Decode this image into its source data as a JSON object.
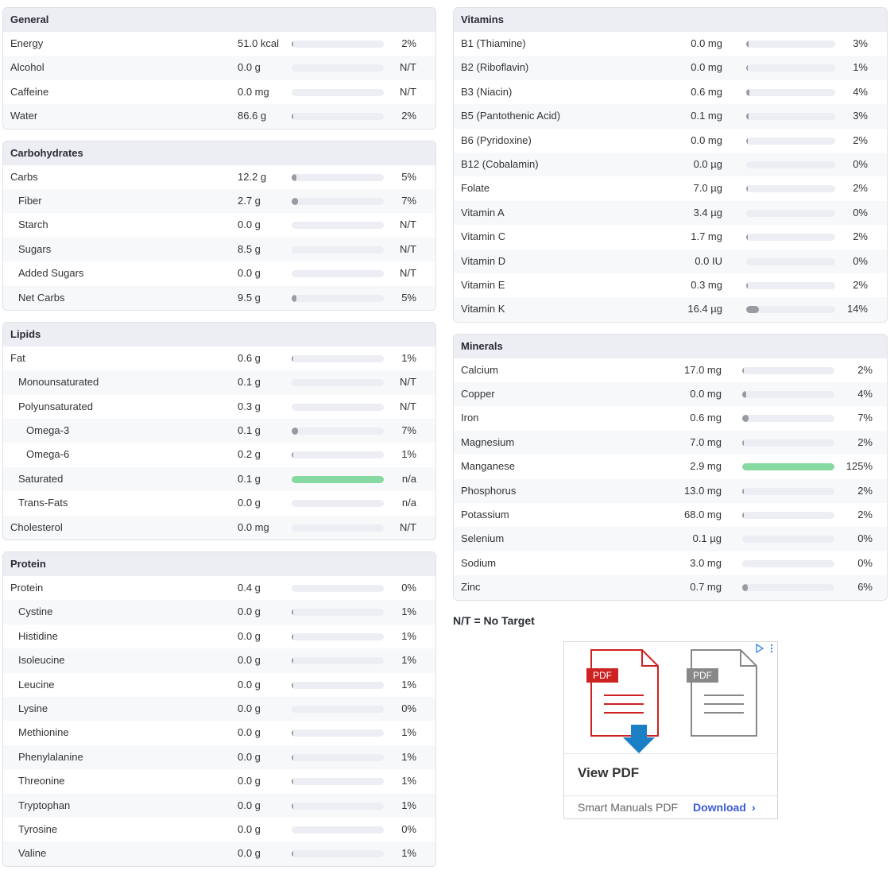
{
  "general": {
    "title": "General",
    "rows": [
      {
        "name": "Energy",
        "amount": "51.0 kcal",
        "pct": "2%",
        "level": 0.02
      },
      {
        "name": "Alcohol",
        "amount": "0.0 g",
        "pct": "N/T",
        "level": 0
      },
      {
        "name": "Caffeine",
        "amount": "0.0 mg",
        "pct": "N/T",
        "level": 0
      },
      {
        "name": "Water",
        "amount": "86.6 g",
        "pct": "2%",
        "level": 0.02
      }
    ]
  },
  "carbohydrates": {
    "title": "Carbohydrates",
    "rows": [
      {
        "name": "Carbs",
        "amount": "12.2 g",
        "pct": "5%",
        "level": 0.05
      },
      {
        "name": "Fiber",
        "amount": "2.7 g",
        "pct": "7%",
        "level": 0.07
      },
      {
        "name": "Starch",
        "amount": "0.0 g",
        "pct": "N/T",
        "level": 0
      },
      {
        "name": "Sugars",
        "amount": "8.5 g",
        "pct": "N/T",
        "level": 0
      },
      {
        "name": "Added Sugars",
        "amount": "0.0 g",
        "pct": "N/T",
        "level": 0
      },
      {
        "name": "Net Carbs",
        "amount": "9.5 g",
        "pct": "5%",
        "level": 0.05
      }
    ]
  },
  "lipids": {
    "title": "Lipids",
    "rows": [
      {
        "name": "Fat",
        "amount": "0.6 g",
        "pct": "1%",
        "level": 0.01
      },
      {
        "name": "Monounsaturated",
        "amount": "0.1 g",
        "pct": "N/T",
        "level": 0
      },
      {
        "name": "Polyunsaturated",
        "amount": "0.3 g",
        "pct": "N/T",
        "level": 0
      },
      {
        "name": "Omega-3",
        "amount": "0.1 g",
        "pct": "7%",
        "level": 0.07
      },
      {
        "name": "Omega-6",
        "amount": "0.2 g",
        "pct": "1%",
        "level": 0.01
      },
      {
        "name": "Saturated",
        "amount": "0.1 g",
        "pct": "n/a",
        "level": 1.0
      },
      {
        "name": "Trans-Fats",
        "amount": "0.0 g",
        "pct": "n/a",
        "level": 0
      },
      {
        "name": "Cholesterol",
        "amount": "0.0 mg",
        "pct": "N/T",
        "level": 0
      }
    ]
  },
  "protein": {
    "title": "Protein",
    "rows": [
      {
        "name": "Protein",
        "amount": "0.4 g",
        "pct": "0%",
        "level": 0
      },
      {
        "name": "Cystine",
        "amount": "0.0 g",
        "pct": "1%",
        "level": 0.01
      },
      {
        "name": "Histidine",
        "amount": "0.0 g",
        "pct": "1%",
        "level": 0.01
      },
      {
        "name": "Isoleucine",
        "amount": "0.0 g",
        "pct": "1%",
        "level": 0.01
      },
      {
        "name": "Leucine",
        "amount": "0.0 g",
        "pct": "1%",
        "level": 0.01
      },
      {
        "name": "Lysine",
        "amount": "0.0 g",
        "pct": "0%",
        "level": 0
      },
      {
        "name": "Methionine",
        "amount": "0.0 g",
        "pct": "1%",
        "level": 0.01
      },
      {
        "name": "Phenylalanine",
        "amount": "0.0 g",
        "pct": "1%",
        "level": 0.01
      },
      {
        "name": "Threonine",
        "amount": "0.0 g",
        "pct": "1%",
        "level": 0.01
      },
      {
        "name": "Tryptophan",
        "amount": "0.0 g",
        "pct": "1%",
        "level": 0.01
      },
      {
        "name": "Tyrosine",
        "amount": "0.0 g",
        "pct": "0%",
        "level": 0
      },
      {
        "name": "Valine",
        "amount": "0.0 g",
        "pct": "1%",
        "level": 0.01
      }
    ]
  },
  "vitamins": {
    "title": "Vitamins",
    "rows": [
      {
        "name": "B1 (Thiamine)",
        "amount": "0.0 mg",
        "pct": "3%",
        "level": 0.03
      },
      {
        "name": "B2 (Riboflavin)",
        "amount": "0.0 mg",
        "pct": "1%",
        "level": 0.01
      },
      {
        "name": "B3 (Niacin)",
        "amount": "0.6 mg",
        "pct": "4%",
        "level": 0.04
      },
      {
        "name": "B5 (Pantothenic Acid)",
        "amount": "0.1 mg",
        "pct": "3%",
        "level": 0.03
      },
      {
        "name": "B6 (Pyridoxine)",
        "amount": "0.0 mg",
        "pct": "2%",
        "level": 0.02
      },
      {
        "name": "B12 (Cobalamin)",
        "amount": "0.0 µg",
        "pct": "0%",
        "level": 0
      },
      {
        "name": "Folate",
        "amount": "7.0 µg",
        "pct": "2%",
        "level": 0.02
      },
      {
        "name": "Vitamin A",
        "amount": "3.4 µg",
        "pct": "0%",
        "level": 0
      },
      {
        "name": "Vitamin C",
        "amount": "1.7 mg",
        "pct": "2%",
        "level": 0.02
      },
      {
        "name": "Vitamin D",
        "amount": "0.0 IU",
        "pct": "0%",
        "level": 0
      },
      {
        "name": "Vitamin E",
        "amount": "0.3 mg",
        "pct": "2%",
        "level": 0.02
      },
      {
        "name": "Vitamin K",
        "amount": "16.4 µg",
        "pct": "14%",
        "level": 0.14
      }
    ]
  },
  "minerals": {
    "title": "Minerals",
    "rows": [
      {
        "name": "Calcium",
        "amount": "17.0 mg",
        "pct": "2%",
        "level": 0.02
      },
      {
        "name": "Copper",
        "amount": "0.0 mg",
        "pct": "4%",
        "level": 0.04
      },
      {
        "name": "Iron",
        "amount": "0.6 mg",
        "pct": "7%",
        "level": 0.07
      },
      {
        "name": "Magnesium",
        "amount": "7.0 mg",
        "pct": "2%",
        "level": 0.02
      },
      {
        "name": "Manganese",
        "amount": "2.9 mg",
        "pct": "125%",
        "level": 1.0
      },
      {
        "name": "Phosphorus",
        "amount": "13.0 mg",
        "pct": "2%",
        "level": 0.02
      },
      {
        "name": "Potassium",
        "amount": "68.0 mg",
        "pct": "2%",
        "level": 0.02
      },
      {
        "name": "Selenium",
        "amount": "0.1 µg",
        "pct": "0%",
        "level": 0
      },
      {
        "name": "Sodium",
        "amount": "3.0 mg",
        "pct": "0%",
        "level": 0
      },
      {
        "name": "Zinc",
        "amount": "0.7 mg",
        "pct": "6%",
        "level": 0.06
      }
    ]
  },
  "legend": "N/T = No Target",
  "ad": {
    "pdf_label_red": "PDF",
    "pdf_label_gray": "PDF",
    "title": "View PDF",
    "brand": "Smart Manuals PDF",
    "cta": "Download",
    "accent_red": "#cc2222",
    "accent_blue": "#1a7fc4"
  },
  "colors": {
    "bar_track": "#eceef3",
    "bar_fill": "#999ba3",
    "bar_fill_over": "#86d9a1",
    "header_bg": "#eceef3"
  }
}
